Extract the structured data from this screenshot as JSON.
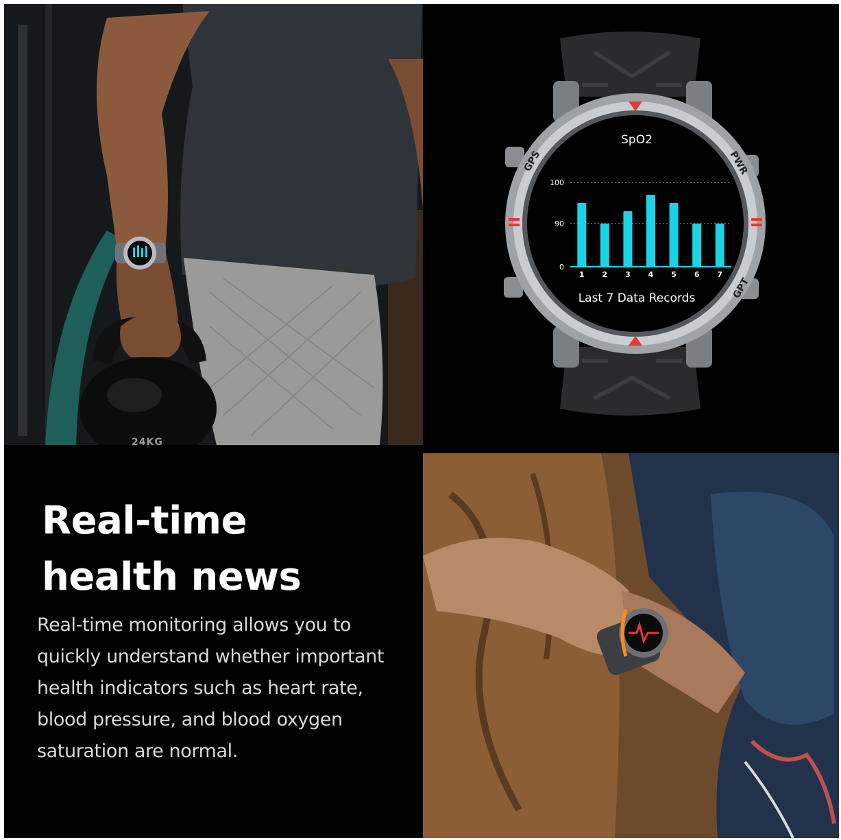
{
  "headline": {
    "line1": "Real-time",
    "line2": "health news"
  },
  "description": [
    "Real-time monitoring allows you to",
    "quickly understand whether important",
    "health indicators such as heart rate,",
    "blood pressure, and blood oxygen",
    "saturation are normal."
  ],
  "gym_photo": {
    "kettlebell_label": "24KG"
  },
  "watch": {
    "bezel_labels": {
      "gps": "GPS",
      "pwr": "PWR",
      "gpt": "GPT"
    },
    "colors": {
      "bars": "#19d3e6",
      "accent_button": "#ff8a1a",
      "markers": "#e53935"
    }
  },
  "chart_data": {
    "type": "bar",
    "title": "SpO2",
    "subtitle": "Last 7 Data Records",
    "categories": [
      "1",
      "2",
      "3",
      "4",
      "5",
      "6",
      "7"
    ],
    "values": [
      95,
      90,
      93,
      97,
      95,
      90,
      90
    ],
    "yticks": [
      "100",
      "90",
      "0"
    ],
    "xlabel": "",
    "ylabel": "",
    "grid": "dotted at 100 and 90"
  }
}
